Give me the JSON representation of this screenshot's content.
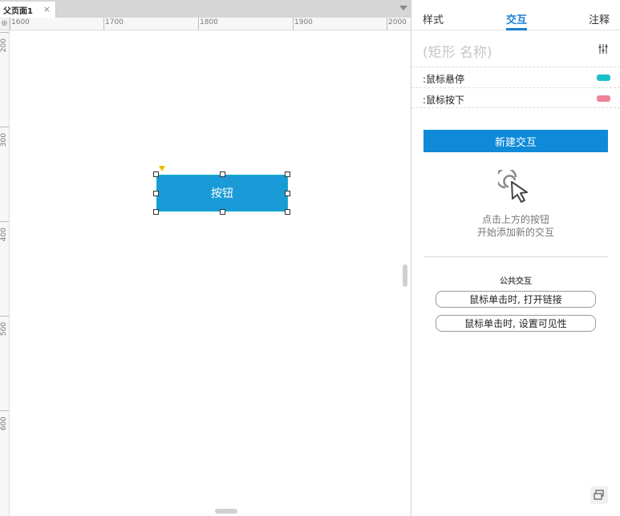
{
  "tab": {
    "label": "父页面1",
    "close": "×"
  },
  "ruler": {
    "corner": "⊕",
    "h_labels": [
      "1600",
      "1700",
      "1800",
      "1900",
      "2000"
    ],
    "v_labels": [
      "200",
      "300",
      "400",
      "500",
      "600"
    ]
  },
  "canvas": {
    "button_label": "按钮"
  },
  "panel": {
    "tabs": {
      "style": "样式",
      "interaction": "交互",
      "notes": "注释"
    },
    "shape_name": "(矩形 名称)",
    "events": [
      {
        "label": ":鼠标悬停",
        "color": "#19c0c6"
      },
      {
        "label": ":鼠标按下",
        "color": "#ee8495"
      }
    ],
    "new_interaction": "新建交互",
    "hint_line1": "点击上方的按钮",
    "hint_line2": "开始添加新的交互",
    "common_title": "公共交互",
    "common_open_link": "鼠标单击时, 打开链接",
    "common_set_visible": "鼠标单击时, 设置可见性"
  },
  "colors": {
    "accent": "#1a7fd6",
    "button_fill": "#1a9bd7",
    "primary_button": "#0e8ad9"
  },
  "icons": [
    "close-icon",
    "dropdown-icon",
    "filter-sliders-icon",
    "click-cursor-icon",
    "restore-window-icon"
  ]
}
